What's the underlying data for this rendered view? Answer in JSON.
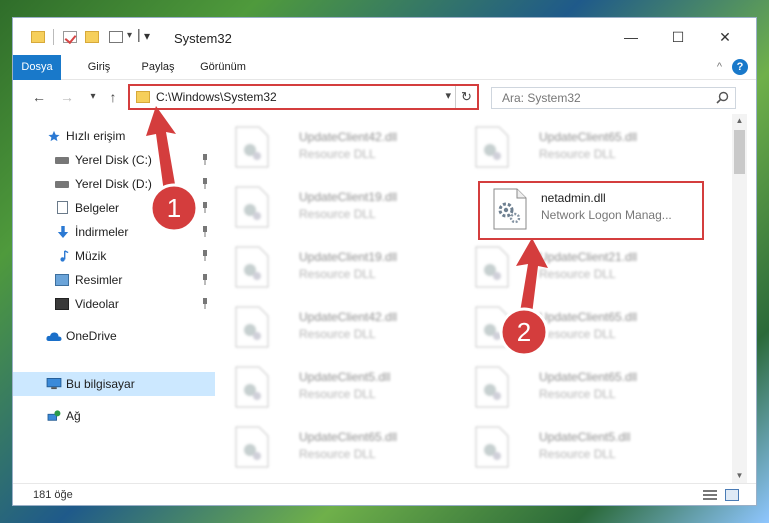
{
  "window": {
    "title": "System32",
    "quick_access_dropdown": "▾",
    "controls": {
      "minimize": "—",
      "maximize": "☐",
      "close": "✕"
    }
  },
  "ribbon": {
    "tabs": [
      {
        "label": "Dosya",
        "active": true
      },
      {
        "label": "Giriş",
        "active": false
      },
      {
        "label": "Paylaş",
        "active": false
      },
      {
        "label": "Görünüm",
        "active": false
      }
    ],
    "collapse_glyph": "^",
    "help_glyph": "?"
  },
  "navigation": {
    "back_glyph": "←",
    "forward_glyph": "→",
    "recent_glyph": "▾",
    "up_glyph": "↑",
    "address": "C:\\Windows\\System32",
    "address_dropdown": "▾",
    "refresh_glyph": "↻",
    "search_placeholder": "Ara: System32"
  },
  "sidebar": {
    "items": [
      {
        "label": "Hızlı erişim",
        "icon": "star-icon",
        "pinned": false,
        "top": true
      },
      {
        "label": "Yerel Disk (C:)",
        "icon": "drive-icon",
        "pinned": true
      },
      {
        "label": "Yerel Disk (D:)",
        "icon": "drive-icon",
        "pinned": true
      },
      {
        "label": "Belgeler",
        "icon": "documents-icon",
        "pinned": true
      },
      {
        "label": "İndirmeler",
        "icon": "download-icon",
        "pinned": true
      },
      {
        "label": "Müzik",
        "icon": "music-icon",
        "pinned": true
      },
      {
        "label": "Resimler",
        "icon": "pictures-icon",
        "pinned": true
      },
      {
        "label": "Videolar",
        "icon": "videos-icon",
        "pinned": true
      },
      {
        "label": "OneDrive",
        "icon": "cloud-icon",
        "pinned": false,
        "top": true
      },
      {
        "label": "Bu bilgisayar",
        "icon": "computer-icon",
        "pinned": false,
        "top": true,
        "selected": true
      },
      {
        "label": "Ağ",
        "icon": "network-icon",
        "pinned": false,
        "top": true
      }
    ]
  },
  "files": [
    {
      "name": "UpdateClient42.dll",
      "desc": "Resource DLL",
      "blurred": true
    },
    {
      "name": "UpdateClient65.dll",
      "desc": "Resource DLL",
      "blurred": true
    },
    {
      "name": "UpdateClient19.dll",
      "desc": "Resource DLL",
      "blurred": true
    },
    {
      "name": "netadmin.dll",
      "desc": "Network Logon Manag...",
      "blurred": false,
      "highlighted": true
    },
    {
      "name": "UpdateClient19.dll",
      "desc": "Resource DLL",
      "blurred": true
    },
    {
      "name": "UpdateClient21.dll",
      "desc": "Resource DLL",
      "blurred": true
    },
    {
      "name": "UpdateClient42.dll",
      "desc": "Resource DLL",
      "blurred": true
    },
    {
      "name": "UpdateClient65.dll",
      "desc": "Resource DLL",
      "blurred": true
    },
    {
      "name": "UpdateClient5.dll",
      "desc": "Resource DLL",
      "blurred": true
    },
    {
      "name": "UpdateClient65.dll",
      "desc": "Resource DLL",
      "blurred": true
    },
    {
      "name": "UpdateClient65.dll",
      "desc": "Resource DLL",
      "blurred": true
    },
    {
      "name": "UpdateClient5.dll",
      "desc": "Resource DLL",
      "blurred": true
    }
  ],
  "status": {
    "item_count": "181 öğe"
  },
  "annotations": {
    "callout_1": "1",
    "callout_2": "2",
    "color": "#d43d3d"
  }
}
